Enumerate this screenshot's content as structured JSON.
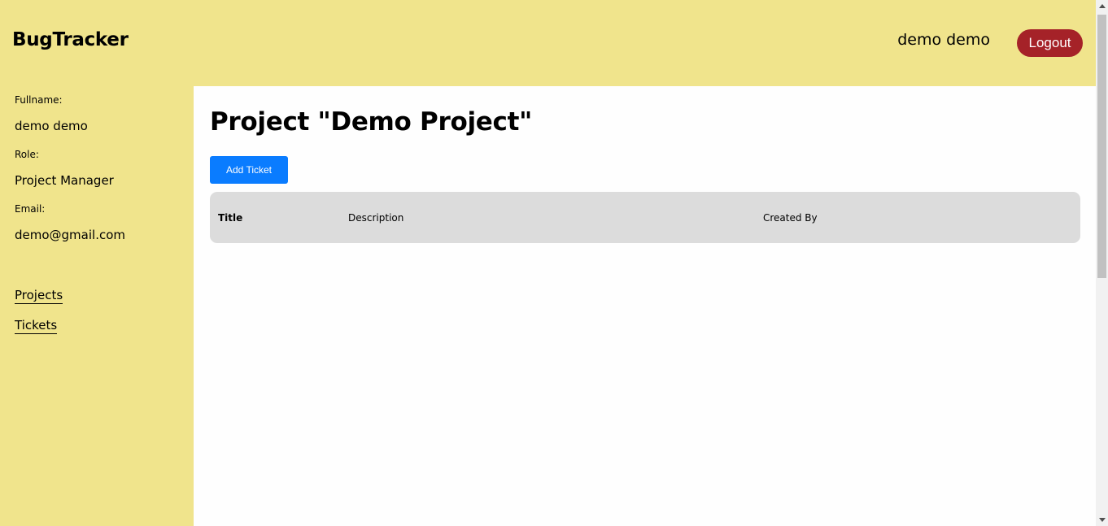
{
  "header": {
    "brand": "BugTracker",
    "user_name": "demo demo",
    "logout_label": "Logout"
  },
  "sidebar": {
    "fullname_label": "Fullname:",
    "fullname_value": "demo demo",
    "role_label": "Role:",
    "role_value": "Project Manager",
    "email_label": "Email:",
    "email_value": "demo@gmail.com",
    "nav": [
      {
        "label": "Projects"
      },
      {
        "label": "Tickets"
      }
    ]
  },
  "main": {
    "title": "Project \"Demo Project\"",
    "add_ticket_label": "Add Ticket",
    "table": {
      "columns": [
        "Title",
        "Description",
        "Created By"
      ],
      "rows": []
    }
  },
  "colors": {
    "header_bg": "#f0e48c",
    "logout_bg": "#a52228",
    "primary_button": "#0a7cff",
    "table_header_bg": "#dcdcdc"
  }
}
